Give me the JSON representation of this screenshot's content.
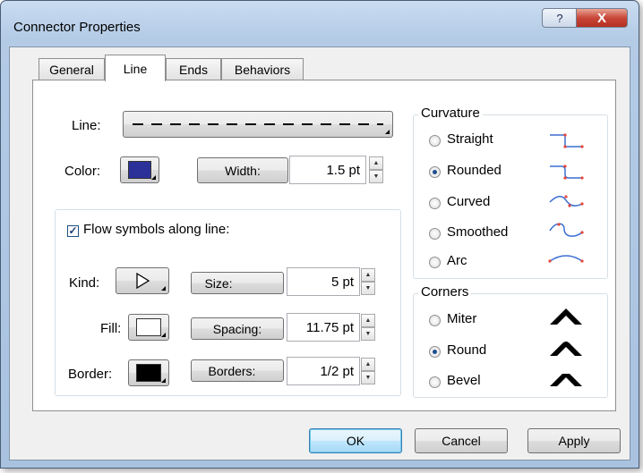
{
  "window": {
    "title": "Connector Properties",
    "help_glyph": "?",
    "close_glyph": "X"
  },
  "tabs": [
    {
      "label": "General"
    },
    {
      "label": "Line"
    },
    {
      "label": "Ends"
    },
    {
      "label": "Behaviors"
    }
  ],
  "line": {
    "line_label": "Line:",
    "color_label": "Color:",
    "color_value": "#2c3199",
    "width_button": "Width:",
    "width_value": "1.5 pt"
  },
  "flow": {
    "checkbox_label": "Flow symbols along line:",
    "checked": true,
    "kind_label": "Kind:",
    "fill_label": "Fill:",
    "fill_color": "#ffffff",
    "border_label": "Border:",
    "border_color": "#000000",
    "size_button": "Size:",
    "size_value": "5 pt",
    "spacing_button": "Spacing:",
    "spacing_value": "11.75 pt",
    "borders_button": "Borders:",
    "borders_value": "1/2 pt"
  },
  "curvature": {
    "title": "Curvature",
    "options": [
      {
        "label": "Straight",
        "selected": false,
        "icon": "straight-curve-icon"
      },
      {
        "label": "Rounded",
        "selected": true,
        "icon": "rounded-curve-icon"
      },
      {
        "label": "Curved",
        "selected": false,
        "icon": "curved-curve-icon"
      },
      {
        "label": "Smoothed",
        "selected": false,
        "icon": "smoothed-curve-icon"
      },
      {
        "label": "Arc",
        "selected": false,
        "icon": "arc-curve-icon"
      }
    ]
  },
  "corners": {
    "title": "Corners",
    "options": [
      {
        "label": "Miter",
        "selected": false,
        "icon": "miter-corner-icon"
      },
      {
        "label": "Round",
        "selected": true,
        "icon": "round-corner-icon"
      },
      {
        "label": "Bevel",
        "selected": false,
        "icon": "bevel-corner-icon"
      }
    ]
  },
  "buttons": {
    "ok": "OK",
    "cancel": "Cancel",
    "apply": "Apply"
  },
  "colors": {
    "accent_blue": "#1f4e8c",
    "curve_point_red": "#e8443a",
    "curve_line_blue": "#3b6fd1"
  }
}
